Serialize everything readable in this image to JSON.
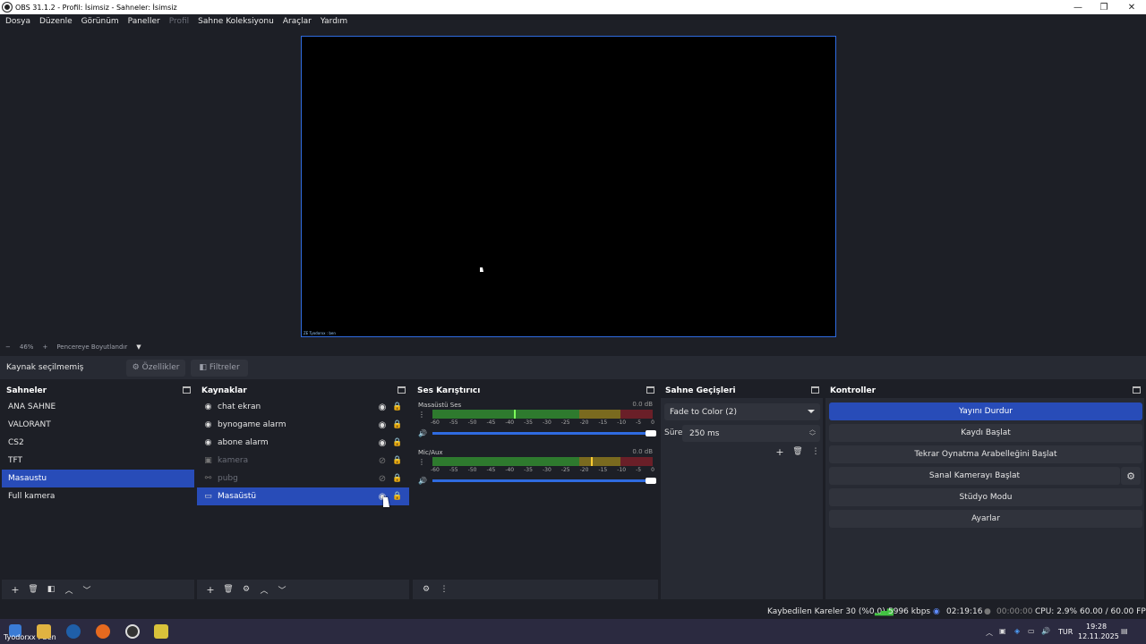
{
  "window": {
    "title": "OBS 31.1.2 - Profil: İsimsiz - Sahneler: İsimsiz",
    "minimize": "—",
    "restore": "❐",
    "close": "✕"
  },
  "menu": {
    "items": [
      "Dosya",
      "Düzenle",
      "Görünüm",
      "Paneller",
      "Profil",
      "Sahne Koleksiyonu",
      "Araçlar",
      "Yardım"
    ],
    "disabled": [
      "Profil"
    ]
  },
  "preview": {
    "overlay_text": "ZE Tyodorxx : ben"
  },
  "zoom": {
    "minus": "−",
    "value": "46%",
    "plus": "+",
    "fit_label": "Pencereye Boyutlandır"
  },
  "source_toolbar": {
    "no_selection": "Kaynak seçilmemiş",
    "properties": "Özellikler",
    "filters": "Filtreler"
  },
  "scenes": {
    "title": "Sahneler",
    "items": [
      "ANA SAHNE",
      "VALORANT",
      "CS2",
      "TFT",
      "Masaustu",
      "Full kamera"
    ],
    "selected": "Masaustu"
  },
  "sources": {
    "title": "Kaynaklar",
    "items": [
      {
        "name": "chat ekran",
        "icon": "globe-icon",
        "visible": true
      },
      {
        "name": "bynogame alarm",
        "icon": "globe-icon",
        "visible": true
      },
      {
        "name": "abone alarm",
        "icon": "globe-icon",
        "visible": true
      },
      {
        "name": "kamera",
        "icon": "camera-icon",
        "visible": false
      },
      {
        "name": "pubg",
        "icon": "gamepad-icon",
        "visible": false
      },
      {
        "name": "Masaüstü",
        "icon": "monitor-icon",
        "visible": true
      }
    ],
    "selected": "Masaüstü"
  },
  "mixer": {
    "title": "Ses Karıştırıcı",
    "tracks": [
      {
        "name": "Masaüstü Ses",
        "db": "0.0 dB",
        "level": 0.37
      },
      {
        "name": "Mic/Aux",
        "db": "0.0 dB",
        "level": 0.72
      }
    ],
    "scale": [
      "-60",
      "-55",
      "-50",
      "-45",
      "-40",
      "-35",
      "-30",
      "-25",
      "-20",
      "-15",
      "-10",
      "-5",
      "0"
    ]
  },
  "transitions": {
    "title": "Sahne Geçişleri",
    "selected": "Fade to Color (2)",
    "duration_label": "Süre",
    "duration_value": "250 ms"
  },
  "controls": {
    "title": "Kontroller",
    "stop_stream": "Yayını Durdur",
    "start_recording": "Kaydı Başlat",
    "start_replay": "Tekrar Oynatma Arabelleğini Başlat",
    "start_virtualcam": "Sanal Kamerayı Başlat",
    "studio_mode": "Stüdyo Modu",
    "settings": "Ayarlar"
  },
  "status": {
    "dropped_frames": "Kaybedilen Kareler 30 (%0.0)",
    "bitrate": "5996 kbps",
    "stream_time": "02:19:16",
    "rec_time": "00:00:00",
    "cpu": "CPU: 2.9%",
    "fps": "60.00 / 60.00 FPS"
  },
  "taskbar": {
    "notification_text": "Tyodorxx : ben",
    "lang": "TUR",
    "time": "19:28",
    "date": "12.11.2025"
  },
  "colors": {
    "accent": "#284cb8",
    "preview_border": "#2f6be0",
    "background": "#1d1f26"
  }
}
